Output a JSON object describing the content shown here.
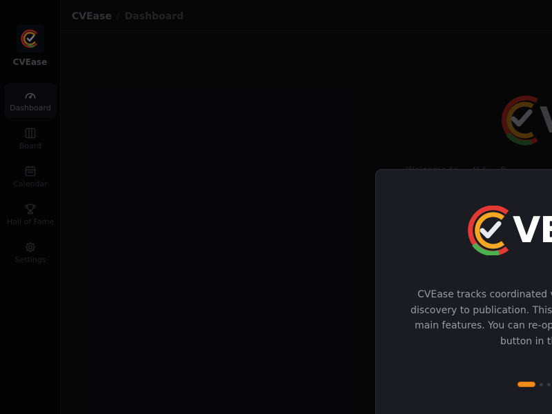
{
  "app": {
    "name": "CVEase"
  },
  "sidebar": {
    "brand_name": "CVEase",
    "items": [
      {
        "label": "Dashboard",
        "icon": "gauge-icon",
        "active": true
      },
      {
        "label": "Board",
        "icon": "columns-icon",
        "active": false
      },
      {
        "label": "Calendar",
        "icon": "calendar-icon",
        "active": false
      },
      {
        "label": "Hall of Fame",
        "icon": "trophy-icon",
        "active": false
      },
      {
        "label": "Settings",
        "icon": "gear-icon",
        "active": false
      }
    ]
  },
  "header": {
    "breadcrumb_root": "CVEase",
    "breadcrumb_separator": "/",
    "breadcrumb_current": "Dashboard"
  },
  "background": {
    "hero_wordmark": "V",
    "welcome_text": "Welcome to ... tt t ... fi"
  },
  "modal": {
    "wordmark": "VE",
    "text_lines": [
      "CVEase tracks coordinated v",
      "discovery to publication. This",
      "main features. You can re-op",
      "button in th"
    ],
    "step_current": 1
  },
  "colors": {
    "accent": "#f28c18",
    "logo_red": "#e53935",
    "logo_orange": "#f5a623",
    "logo_green": "#4caf50",
    "modal_bg": "#1b1c22"
  }
}
